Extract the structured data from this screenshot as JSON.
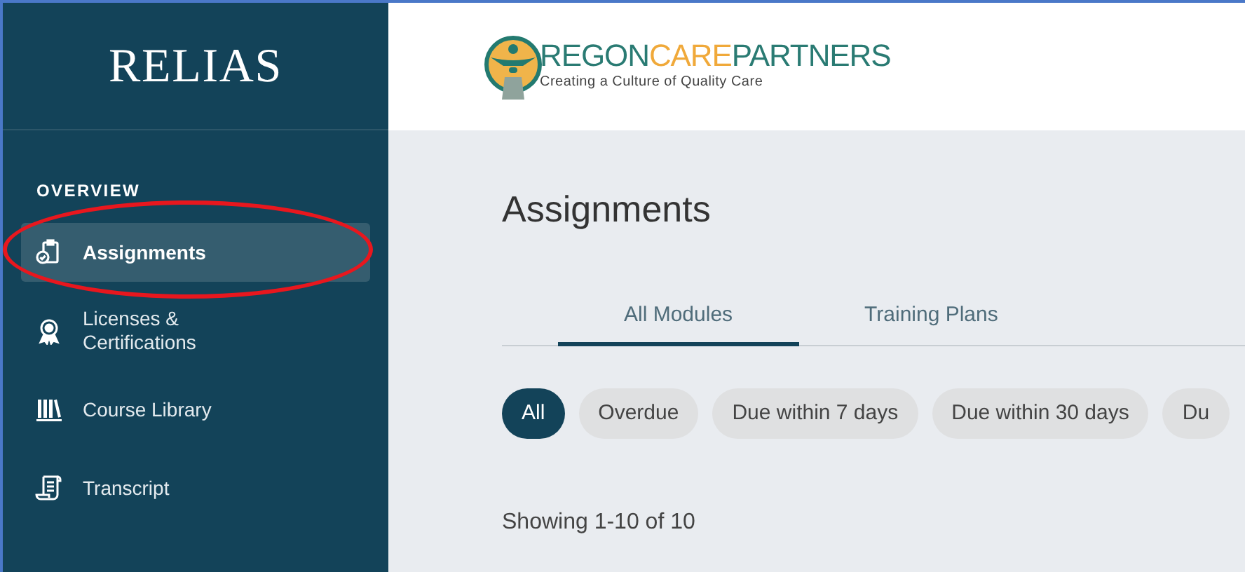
{
  "sidebar": {
    "logo": "RELIAS",
    "section": "OVERVIEW",
    "items": [
      {
        "label": "Assignments",
        "selected": true
      },
      {
        "label": "Licenses & Certifications",
        "selected": false
      },
      {
        "label": "Course Library",
        "selected": false
      },
      {
        "label": "Transcript",
        "selected": false
      }
    ]
  },
  "header": {
    "logo_parts": [
      "REGON",
      "CARE",
      "PARTNERS"
    ],
    "tagline": "Creating a Culture of Quality Care"
  },
  "main": {
    "title": "Assignments",
    "tabs": [
      {
        "label": "All Modules",
        "selected": true
      },
      {
        "label": "Training Plans",
        "selected": false
      }
    ],
    "filters": [
      {
        "label": "All",
        "selected": true
      },
      {
        "label": "Overdue",
        "selected": false
      },
      {
        "label": "Due within 7 days",
        "selected": false
      },
      {
        "label": "Due within 30 days",
        "selected": false
      },
      {
        "label": "Du",
        "selected": false
      }
    ],
    "count": "Showing 1-10 of 10"
  },
  "annotation": {
    "kind": "ellipse"
  }
}
